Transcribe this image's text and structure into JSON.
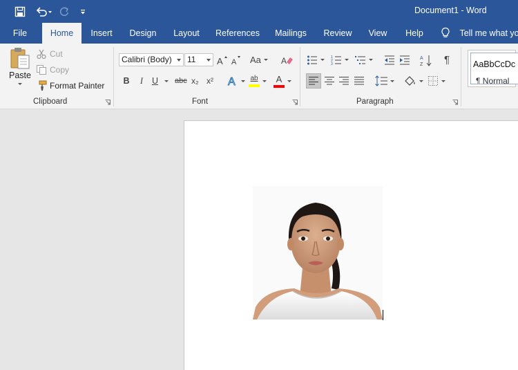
{
  "title_bar": {
    "document_title": "Document1  -  Word"
  },
  "quick_access": {
    "save_icon": "save-icon",
    "undo_icon": "undo-icon",
    "redo_icon": "redo-icon",
    "customize_icon": "customize-qat-icon"
  },
  "tabs": [
    {
      "label": "File"
    },
    {
      "label": "Home"
    },
    {
      "label": "Insert"
    },
    {
      "label": "Design"
    },
    {
      "label": "Layout"
    },
    {
      "label": "References"
    },
    {
      "label": "Mailings"
    },
    {
      "label": "Review"
    },
    {
      "label": "View"
    },
    {
      "label": "Help"
    }
  ],
  "active_tab": "Home",
  "tell_me": {
    "label": "Tell me what yo",
    "icon": "lightbulb-icon"
  },
  "clipboard": {
    "paste_label": "Paste",
    "cut_label": "Cut",
    "copy_label": "Copy",
    "format_painter_label": "Format Painter",
    "group_label": "Clipboard"
  },
  "font": {
    "font_name": "Calibri (Body)",
    "font_size": "11",
    "change_case_label": "Aa",
    "bold_label": "B",
    "italic_label": "I",
    "underline_label": "U",
    "strikethrough_label": "abc",
    "subscript_label": "x₂",
    "superscript_label": "x²",
    "highlight_label": "ab",
    "font_color_label": "A",
    "highlight_color": "#ffff00",
    "font_color": "#ff0000",
    "group_label": "Font"
  },
  "paragraph": {
    "pilcrow_label": "¶",
    "group_label": "Paragraph"
  },
  "styles": {
    "preview_label": "AaBbCcDc",
    "style_name": "¶ Normal"
  },
  "colors": {
    "word_blue": "#2b579a",
    "ribbon_bg": "#f3f3f3",
    "canvas_bg": "#e6e6e6"
  }
}
